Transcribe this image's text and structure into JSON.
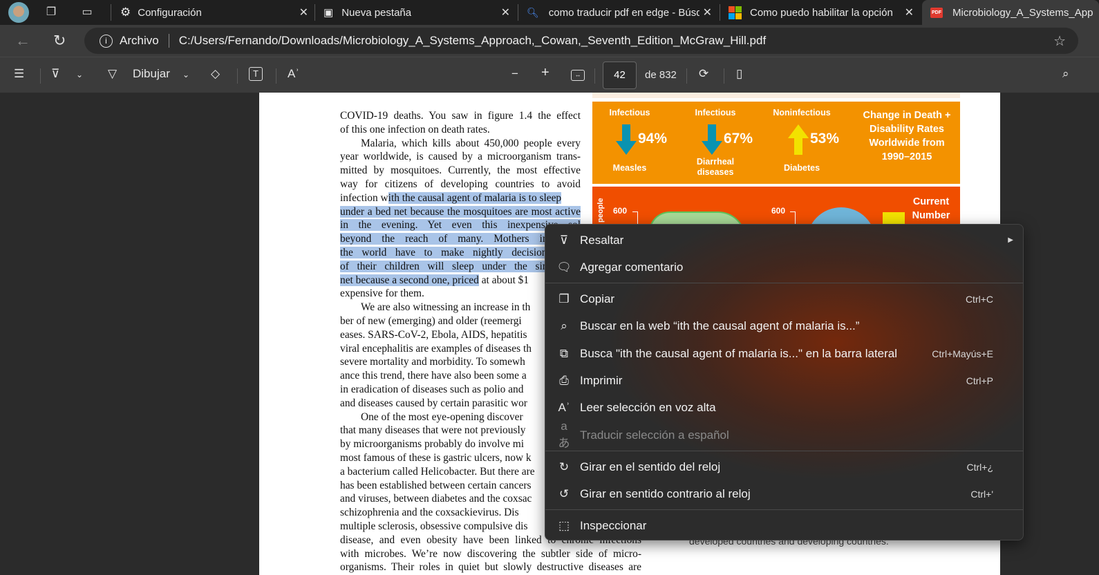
{
  "tabs": [
    {
      "label": "Configuración",
      "icon": "gear-icon"
    },
    {
      "label": "Nueva pestaña",
      "icon": "new-tab-icon"
    },
    {
      "label": "como traducir pdf en edge - Búsq",
      "icon": "search-icon"
    },
    {
      "label": "Como puedo habilitar la opción de",
      "icon": "microsoft-logo-icon"
    },
    {
      "label": "Microbiology_A_Systems_App",
      "icon": "pdf-icon",
      "active": true
    }
  ],
  "address": {
    "scheme_label": "Archivo",
    "url": "C:/Users/Fernando/Downloads/Microbiology_A_Systems_Approach,_Cowan,_Seventh_Edition_McGraw_Hill.pdf"
  },
  "pdf_toolbar": {
    "draw_label": "Dibujar",
    "page_current": "42",
    "page_total": "de 832"
  },
  "document": {
    "lines": [
      {
        "t": "COVID-19 deaths. You saw in  figure 1.4 the effect",
        "j": 1
      },
      {
        "t": "of this one infection on death rates."
      },
      {
        "t": "Malaria, which kills about 450,000 people every",
        "i": 1,
        "j": 1
      },
      {
        "t": "year worldwide, is caused by a microorganism trans-",
        "j": 1
      },
      {
        "t": "mitted by mosquitoes. Currently, the most effective",
        "j": 1
      },
      {
        "t": "way for citizens of developing countries to avoid",
        "j": 1
      },
      {
        "t": "infection w",
        "h": "ith the causal agent of malaria is to sleep"
      },
      {
        "h": "under a bed net because the mosquitoes are most active"
      },
      {
        "h": "in the evening. Yet even this inexpensive sol"
      },
      {
        "h": "beyond the reach of many. Mothers in some"
      },
      {
        "h": "the world have to make nightly decisions abou"
      },
      {
        "h": "of their children will sleep under the single far"
      },
      {
        "h": "net because a second one, priced",
        "t2": " at about $1"
      },
      {
        "t": "expensive for them."
      },
      {
        "t": "We are also witnessing an increase in th",
        "i": 1
      },
      {
        "t": "ber of new (emerging) and older (reemergi"
      },
      {
        "t": "eases. SARS-CoV-2, Ebola, AIDS, hepatitis"
      },
      {
        "t": "viral encephalitis are examples of diseases th"
      },
      {
        "t": "severe mortality and morbidity. To somewh"
      },
      {
        "t": "ance this trend, there have also been some a"
      },
      {
        "t": "in eradication of diseases such as polio and"
      },
      {
        "t": "and diseases caused by certain parasitic wor"
      },
      {
        "t": "One of the most eye-opening discover",
        "i": 1
      },
      {
        "t": "that many diseases that were not previously"
      },
      {
        "t": "by microorganisms probably do involve mi"
      },
      {
        "t": "most famous of these is gastric ulcers, now k"
      },
      {
        "t": "a bacterium called Helicobacter. But there are"
      },
      {
        "t": "has been established between certain cancers"
      },
      {
        "t": "and viruses, between diabetes and the coxsac"
      },
      {
        "t": "schizophrenia and the coxsackievirus. Dis"
      },
      {
        "t": "multiple sclerosis, obsessive compulsive dis"
      },
      {
        "t": "disease, and even obesity have been linked to chronic infections",
        "w": 1
      },
      {
        "t": "with microbes. We’re now discovering the subtler side of micro-",
        "w": 1
      },
      {
        "t": "organisms. Their roles in quiet but slowly destructive diseases are",
        "w": 1
      }
    ],
    "caption_fragment": "developed countries and developing countries.",
    "infographic": {
      "stats": [
        {
          "category": "Infectious",
          "percent": "94%",
          "disease": "Measles",
          "direction": "down"
        },
        {
          "category": "Infectious",
          "percent": "67%",
          "disease": "Diarrheal diseases",
          "direction": "down"
        },
        {
          "category": "Noninfectious",
          "percent": "53%",
          "disease": "Diabetes",
          "direction": "up"
        }
      ],
      "change_title": "Change in Death + Disability Rates Worldwide from 1990–2015",
      "axis_label": "people",
      "tick_left": "600",
      "tick_right": "600",
      "current_number": "Current Number",
      "colors": {
        "orange": "#f39200",
        "red": "#f04e00",
        "arrow_down": "#0a93b0",
        "arrow_up": "#f2e200"
      }
    }
  },
  "context_menu": {
    "items": [
      {
        "label": "Resaltar",
        "icon": "highlighter-icon",
        "submenu": true
      },
      {
        "label": "Agregar comentario",
        "icon": "comment-icon"
      },
      {
        "label": "Copiar",
        "icon": "copy-icon",
        "shortcut": "Ctrl+C"
      },
      {
        "label": "Buscar en la web “ith the causal agent of malaria is...”",
        "icon": "search-icon"
      },
      {
        "label": "Busca \"ith the causal agent of malaria is...\" en la barra lateral",
        "icon": "sidebar-search-icon",
        "shortcut": "Ctrl+Mayús+E"
      },
      {
        "label": "Imprimir",
        "icon": "print-icon",
        "shortcut": "Ctrl+P"
      },
      {
        "label": "Leer selección en voz alta",
        "icon": "read-aloud-icon"
      },
      {
        "label": "Traducir selección a español",
        "icon": "translate-icon",
        "disabled": true
      },
      {
        "label": "Girar en el sentido del reloj",
        "icon": "rotate-clockwise-icon",
        "shortcut": "Ctrl+¿"
      },
      {
        "label": "Girar en sentido contrario al reloj",
        "icon": "rotate-counterclockwise-icon",
        "shortcut": "Ctrl+'"
      },
      {
        "label": "Inspeccionar",
        "icon": "inspect-icon"
      }
    ]
  }
}
